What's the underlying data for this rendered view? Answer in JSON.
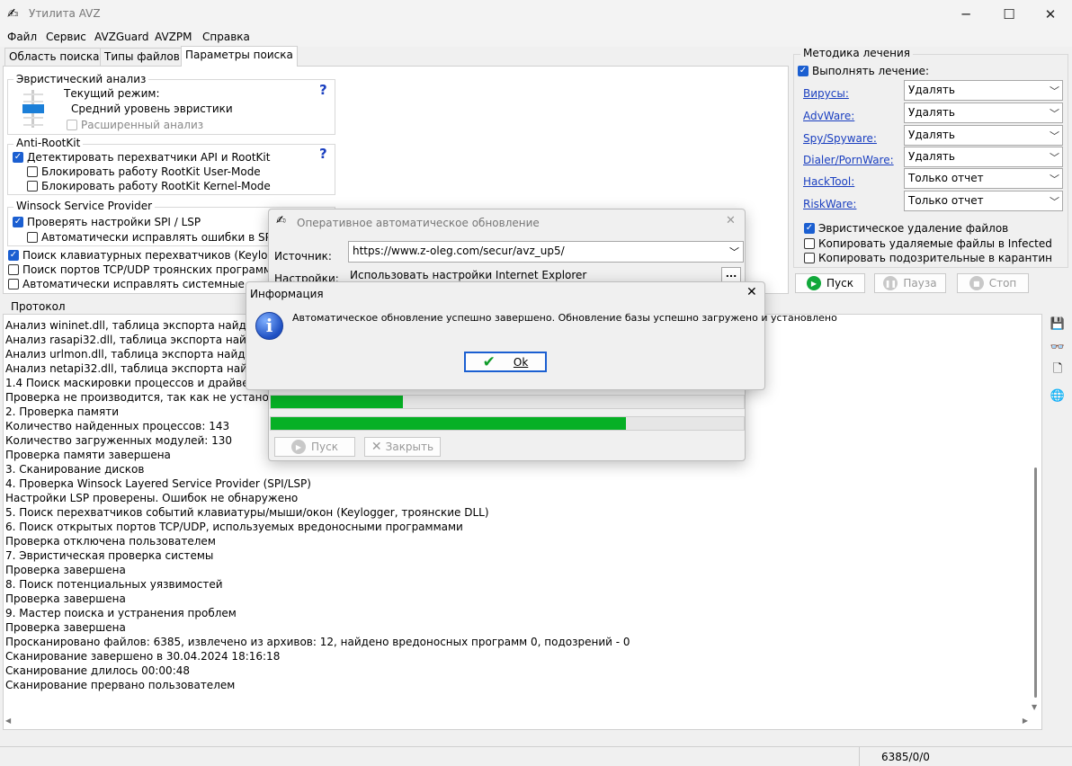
{
  "window": {
    "title": "Утилита AVZ"
  },
  "menu": [
    "Файл",
    "Сервис",
    "AVZGuard",
    "AVZPM",
    "Справка"
  ],
  "tabs": [
    "Область поиска",
    "Типы файлов",
    "Параметры поиска"
  ],
  "heuristic": {
    "title": "Эвристический анализ",
    "mode_label": "Текущий режим:",
    "mode_value": "Средний уровень эвристики",
    "extended": "Расширенный анализ",
    "help": "?"
  },
  "antirootkit": {
    "title": "Anti-RootKit",
    "detect": "Детектировать перехватчики API и RootKit",
    "block_user": "Блокировать работу RootKit User-Mode",
    "block_kernel": "Блокировать работу RootKit Kernel-Mode",
    "help": "?"
  },
  "winsock": {
    "title": "Winsock  Service Provider",
    "check": "Проверять настройки SPI / LSP",
    "autofix": "Автоматически исправлять ошибки в SPI/LSP"
  },
  "options": {
    "keylogger": "Поиск клавиатурных перехватчиков (Keylogger)",
    "ports": "Поиск портов TCP/UDP троянских программ",
    "autofix_sys": "Автоматически исправлять системные ошибки"
  },
  "treatment": {
    "title": "Методика лечения",
    "perform": "Выполнять лечение:",
    "rows": [
      {
        "label": "Вирусы:",
        "value": "Удалять"
      },
      {
        "label": "AdvWare:",
        "value": "Удалять"
      },
      {
        "label": "Spy/Spyware:",
        "value": "Удалять"
      },
      {
        "label": "Dialer/PornWare:",
        "value": "Удалять"
      },
      {
        "label": "HackTool:",
        "value": "Только отчет"
      },
      {
        "label": "RiskWare:",
        "value": "Только отчет"
      }
    ],
    "heuristic_delete": "Эвристическое удаление файлов",
    "copy_deleted": "Копировать удаляемые файлы в  Infected",
    "copy_suspicious": "Копировать подозрительные в  карантин"
  },
  "controls": {
    "start": "Пуск",
    "pause": "Пауза",
    "stop": "Стоп"
  },
  "protocol": {
    "title": "Протокол",
    "lines": [
      " Анализ wininet.dll, таблица экспорта найдена в секции .text",
      " Анализ rasapi32.dll, таблица экспорта найдена в секции .text",
      " Анализ urlmon.dll, таблица экспорта найдена в секции .text",
      " Анализ netapi32.dll, таблица экспорта найдена в секции .text",
      "1.4 Поиск маскировки процессов и драйверов",
      " Проверка не производится, так как не установлен драйвер мониторинга AVZPM",
      "2. Проверка памяти",
      " Количество найденных процессов: 143",
      " Количество загруженных модулей: 130",
      "Проверка памяти завершена",
      "3. Сканирование дисков",
      "4. Проверка Winsock Layered Service Provider (SPI/LSP)",
      " Настройки LSP проверены. Ошибок не обнаружено",
      "5. Поиск перехватчиков событий клавиатуры/мыши/окон (Keylogger, троянские DLL)",
      "6. Поиск открытых портов TCP/UDP, используемых вредоносными программами",
      " Проверка отключена пользователем",
      "7. Эвристическая проверка системы",
      "Проверка завершена",
      "8. Поиск потенциальных уязвимостей",
      "Проверка завершена",
      "9. Мастер поиска и устранения проблем",
      "Проверка завершена",
      "Просканировано файлов: 6385, извлечено из архивов: 12, найдено вредоносных программ 0, подозрений - 0",
      "Сканирование завершено в 30.04.2024 18:16:18",
      "Сканирование длилось 00:00:48",
      "Сканирование прервано пользователем"
    ]
  },
  "status": {
    "counter": "6385/0/0"
  },
  "update_dialog": {
    "title": "Оперативное автоматическое обновление",
    "source_label": "Источник:",
    "source_value": "https://www.z-oleg.com/secur/avz_up5/",
    "settings_label": "Настройки:",
    "settings_value": "Использовать настройки Internet Explorer",
    "more": "...",
    "progress1": 0.28,
    "progress2": 0.75,
    "start": "Пуск",
    "close": "Закрыть"
  },
  "info_dialog": {
    "title": "Информация",
    "message": "Автоматическое обновление успешно завершено. Обновление базы успешно загружено и установлено",
    "ok": "Ok"
  },
  "colors": {
    "accent": "#1b5fd1",
    "progress": "#06b025",
    "link": "#1a3fc0"
  }
}
